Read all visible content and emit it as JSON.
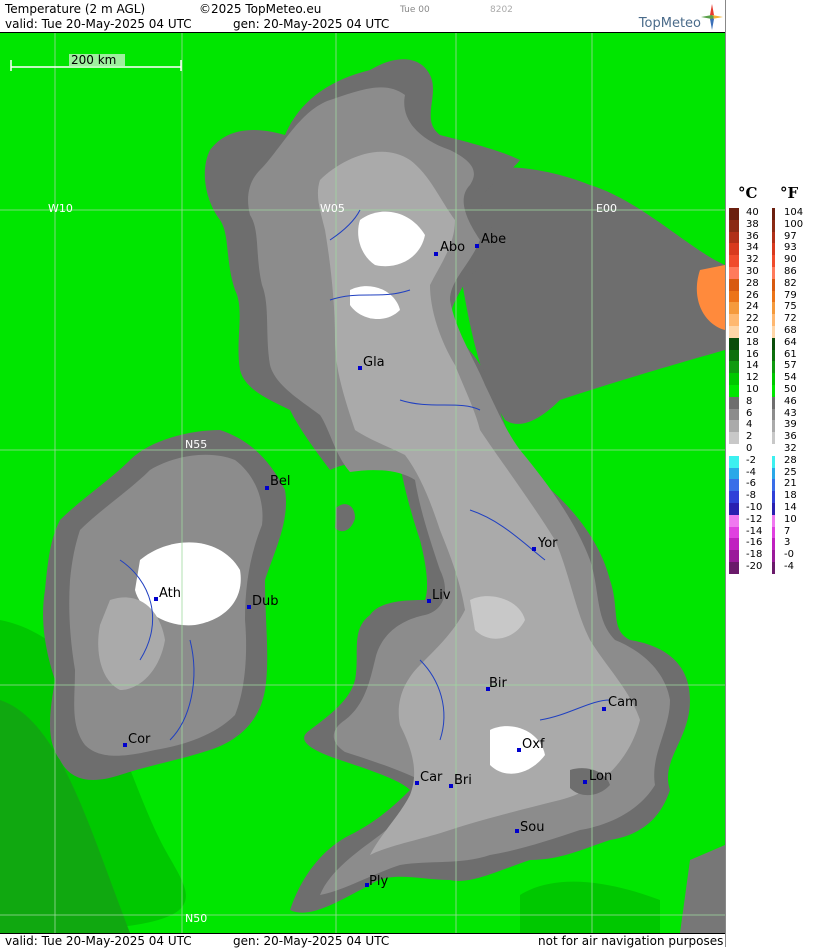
{
  "header": {
    "title": "Temperature (2 m AGL)",
    "copyright": "©2025 TopMeteo.eu",
    "run": "Tue 00",
    "code": "8202",
    "valid": "valid:  Tue  20-May-2025  04 UTC",
    "gen": "gen: 20-May-2025 04 UTC"
  },
  "logo": {
    "text": "TopMeteo",
    "icon": "compass-star-icon"
  },
  "footer": {
    "valid": "valid:  Tue  20-May-2025  04 UTC",
    "gen": "gen: 20-May-2025 04 UTC",
    "note": "not for air navigation purposes"
  },
  "map": {
    "scale_label": "200 km",
    "grid_labels": {
      "w10": "W10",
      "w05": "W05",
      "e00": "E00",
      "n55": "N55",
      "n50": "N50"
    },
    "cities": [
      {
        "name": "Abo"
      },
      {
        "name": "Abe"
      },
      {
        "name": "Gla"
      },
      {
        "name": "Bel"
      },
      {
        "name": "Yor"
      },
      {
        "name": "Ath"
      },
      {
        "name": "Dub"
      },
      {
        "name": "Liv"
      },
      {
        "name": "Bir"
      },
      {
        "name": "Cam"
      },
      {
        "name": "Cor"
      },
      {
        "name": "Oxf"
      },
      {
        "name": "Car"
      },
      {
        "name": "Bri"
      },
      {
        "name": "Lon"
      },
      {
        "name": "Sou"
      },
      {
        "name": "Ply"
      }
    ]
  },
  "legend": {
    "unit_c": "°C",
    "unit_f": "°F",
    "rows": [
      {
        "c": "40",
        "f": "104",
        "color": "#6b1f0f"
      },
      {
        "c": "38",
        "f": "100",
        "color": "#8b2a14"
      },
      {
        "c": "36",
        "f": "97",
        "color": "#b03018"
      },
      {
        "c": "34",
        "f": "93",
        "color": "#d83a1e"
      },
      {
        "c": "32",
        "f": "90",
        "color": "#f04c2c"
      },
      {
        "c": "30",
        "f": "86",
        "color": "#ff7b5c"
      },
      {
        "c": "28",
        "f": "82",
        "color": "#d85a10"
      },
      {
        "c": "26",
        "f": "79",
        "color": "#ec7418"
      },
      {
        "c": "24",
        "f": "75",
        "color": "#f59a3c"
      },
      {
        "c": "22",
        "f": "72",
        "color": "#ffb870"
      },
      {
        "c": "20",
        "f": "68",
        "color": "#ffd6a8"
      },
      {
        "c": "18",
        "f": "64",
        "color": "#0a4d0a"
      },
      {
        "c": "16",
        "f": "61",
        "color": "#0d700d"
      },
      {
        "c": "14",
        "f": "57",
        "color": "#109a10"
      },
      {
        "c": "12",
        "f": "54",
        "color": "#00c800"
      },
      {
        "c": "10",
        "f": "50",
        "color": "#00e600"
      },
      {
        "c": "8",
        "f": "46",
        "color": "#6e6e6e"
      },
      {
        "c": "6",
        "f": "43",
        "color": "#8c8c8c"
      },
      {
        "c": "4",
        "f": "39",
        "color": "#aaaaaa"
      },
      {
        "c": "2",
        "f": "36",
        "color": "#c8c8c8"
      },
      {
        "c": "0",
        "f": "32",
        "color": "#ffffff"
      },
      {
        "c": "-2",
        "f": "28",
        "color": "#3cf0f0"
      },
      {
        "c": "-4",
        "f": "25",
        "color": "#2aa8e8"
      },
      {
        "c": "-6",
        "f": "21",
        "color": "#3a6ee8"
      },
      {
        "c": "-8",
        "f": "18",
        "color": "#3040d8"
      },
      {
        "c": "-10",
        "f": "14",
        "color": "#2a20b0"
      },
      {
        "c": "-12",
        "f": "10",
        "color": "#f078f0"
      },
      {
        "c": "-14",
        "f": "7",
        "color": "#e040e0"
      },
      {
        "c": "-16",
        "f": "3",
        "color": "#c020c0"
      },
      {
        "c": "-18",
        "f": "-0",
        "color": "#9a1a9a"
      },
      {
        "c": "-20",
        "f": "-4",
        "color": "#6a1a6a"
      }
    ]
  }
}
